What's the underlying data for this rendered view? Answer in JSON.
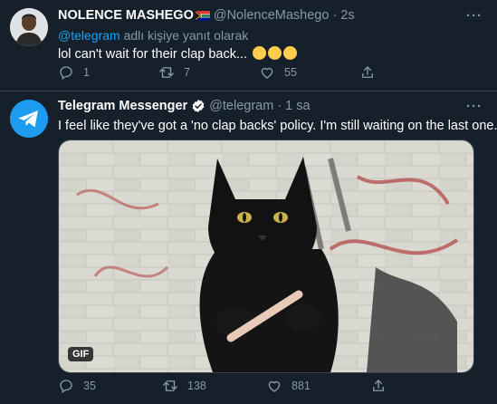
{
  "tweets": [
    {
      "author_name": "NOLENCE MASHEGO",
      "author_handle": "@NolenceMashego",
      "separator": "·",
      "time": "2s",
      "reply_mention": "@telegram",
      "reply_suffix": "adlı kişiye yanıt olarak",
      "text": "lol can't wait for their clap back...",
      "emojis": [
        "joy-emoji",
        "joy-emoji",
        "joy-emoji"
      ],
      "replies": "1",
      "retweets": "7",
      "likes": "55"
    },
    {
      "author_name": "Telegram Messenger",
      "author_handle": "@telegram",
      "separator": "·",
      "time": "1 sa",
      "text": "I feel like they've got a 'no clap backs' policy. I'm still waiting on the last one.",
      "media_badge": "GIF",
      "replies": "35",
      "retweets": "138",
      "likes": "881"
    }
  ],
  "colors": {
    "background": "#15202b",
    "muted": "#8899a6",
    "accent": "#1da1f2",
    "divider": "#38444d"
  },
  "icons": [
    "reply-icon",
    "retweet-icon",
    "like-icon",
    "share-icon",
    "more-icon",
    "verified-badge-icon",
    "telegram-logo-icon",
    "south-africa-flag-icon"
  ]
}
